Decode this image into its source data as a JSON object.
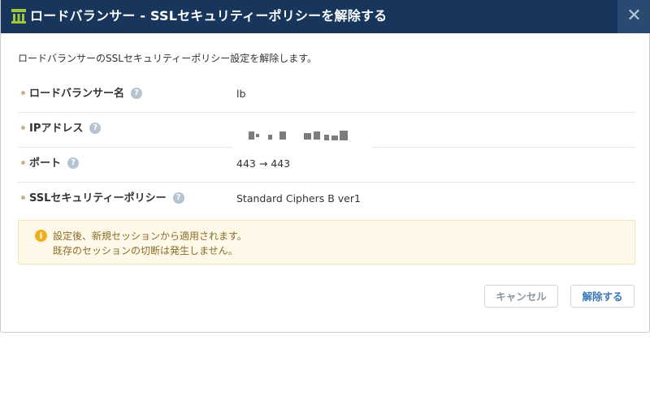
{
  "dialog": {
    "title": "ロードバランサー - SSLセキュリティーポリシーを解除する",
    "close_glyph": "✕",
    "intro": "ロードバランサーのSSLセキュリティーポリシー設定を解除します。"
  },
  "fields": [
    {
      "label": "ロードバランサー名",
      "value": "lb"
    },
    {
      "label": "IPアドレス",
      "value": ""
    },
    {
      "label": "ポート",
      "value": "443 → 443"
    },
    {
      "label": "SSLセキュリティーポリシー",
      "value": "Standard Ciphers B ver1"
    }
  ],
  "help_glyph": "?",
  "notice": {
    "icon": "i",
    "line1": "設定後、新規セッションから適用されます。",
    "line2": "既存のセッションの切断は発生しません。"
  },
  "buttons": {
    "cancel": "キャンセル",
    "release": "解除する"
  },
  "colors": {
    "header_bg": "#18365c",
    "accent": "#3b77b8",
    "notice_bg": "#fdf8e7",
    "notice_text": "#8a6d2b",
    "warning_icon": "#f0ad1c"
  }
}
